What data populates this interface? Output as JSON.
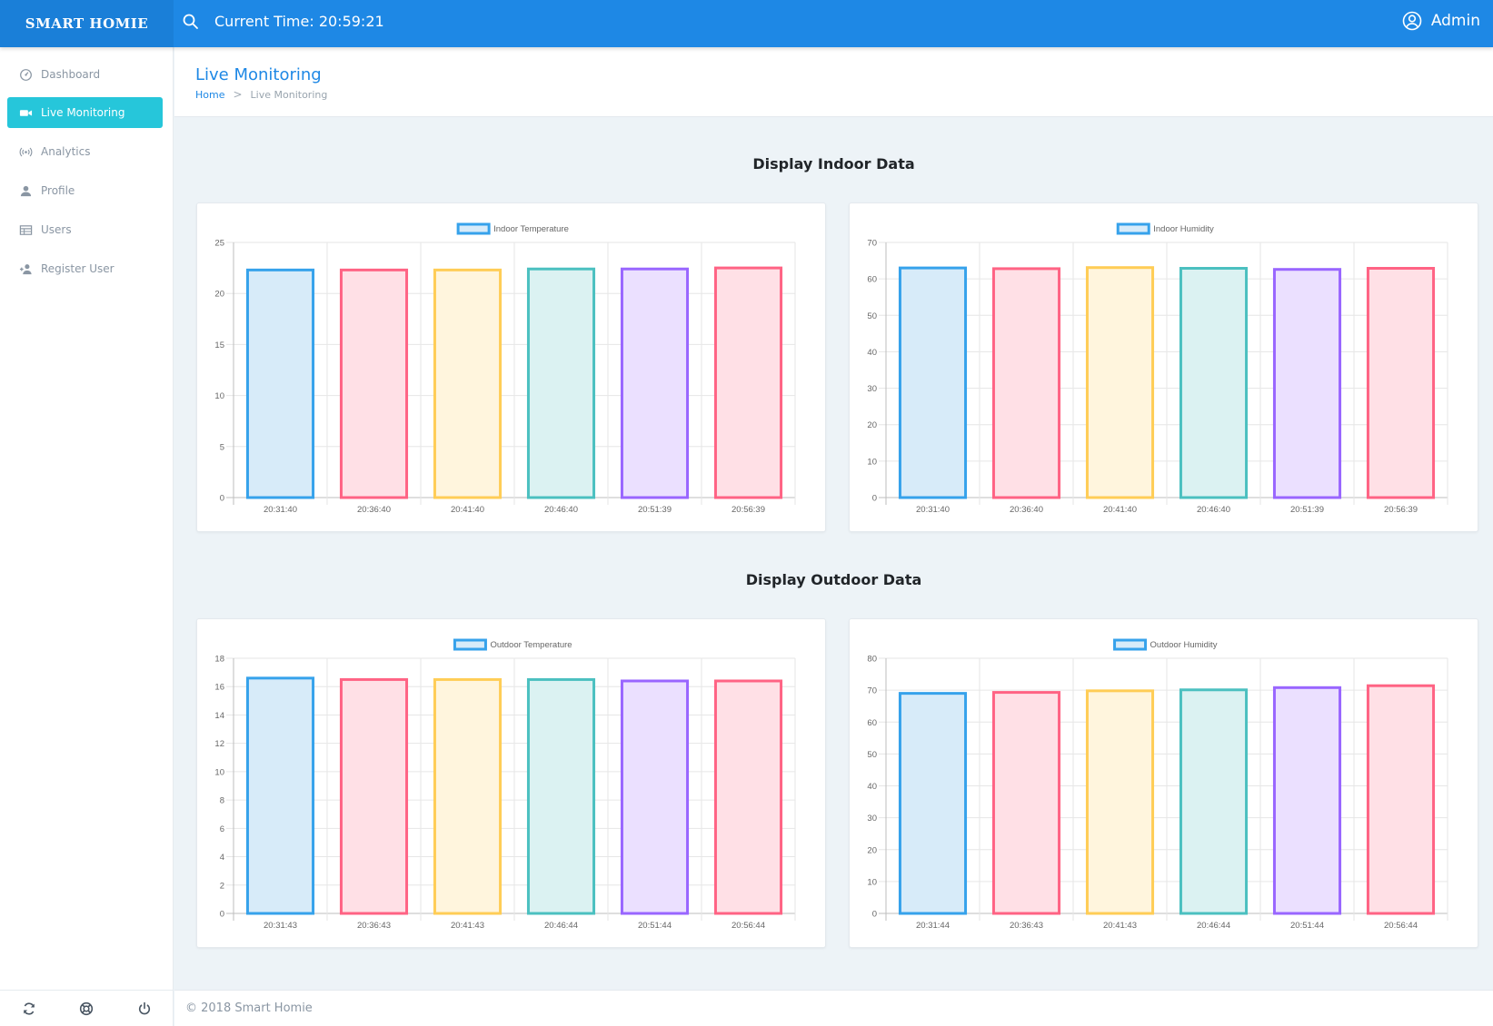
{
  "app": {
    "brand": "SMART HOMIE",
    "clock_text": "Current Time: 20:59:21",
    "user_name": "Admin"
  },
  "sidebar": {
    "items": [
      {
        "label": "Dashboard",
        "icon": "dashboard-icon",
        "active": false
      },
      {
        "label": "Live Monitoring",
        "icon": "video-camera-icon",
        "active": true
      },
      {
        "label": "Analytics",
        "icon": "broadcast-icon",
        "active": false
      },
      {
        "label": "Profile",
        "icon": "person-icon",
        "active": false
      },
      {
        "label": "Users",
        "icon": "table-icon",
        "active": false
      },
      {
        "label": "Register User",
        "icon": "add-user-icon",
        "active": false
      }
    ],
    "footer_icons": [
      "refresh-icon",
      "lifebuoy-icon",
      "power-icon"
    ]
  },
  "page": {
    "title": "Live Monitoring",
    "breadcrumb": {
      "home": "Home",
      "separator": ">",
      "current": "Live Monitoring"
    }
  },
  "sections": {
    "indoor_title": "Display Indoor Data",
    "outdoor_title": "Display Outdoor Data"
  },
  "footer": {
    "text": "© 2018 Smart Homie"
  },
  "colors": {
    "primary": "#1e88e5",
    "active_nav": "#26c6da",
    "bar_border": [
      "#36a2eb",
      "#ff6384",
      "#ffcd56",
      "#4bc0c0",
      "#9966ff",
      "#ff6384"
    ],
    "bar_fill": [
      "#d7ebf9",
      "#ffe0e6",
      "#fff5dd",
      "#dbf2f2",
      "#ebe0ff",
      "#ffe0e6"
    ]
  },
  "chart_data": [
    {
      "type": "bar",
      "legend": "Indoor Temperature",
      "categories": [
        "20:31:40",
        "20:36:40",
        "20:41:40",
        "20:46:40",
        "20:51:39",
        "20:56:39"
      ],
      "values": [
        22.3,
        22.3,
        22.3,
        22.4,
        22.4,
        22.5
      ],
      "ylim": [
        0,
        25
      ],
      "yticks": [
        0,
        5,
        10,
        15,
        20,
        25
      ]
    },
    {
      "type": "bar",
      "legend": "Indoor Humidity",
      "categories": [
        "20:31:40",
        "20:36:40",
        "20:41:40",
        "20:46:40",
        "20:51:39",
        "20:56:39"
      ],
      "values": [
        63,
        62.8,
        63.1,
        62.9,
        62.6,
        62.9
      ],
      "ylim": [
        0,
        70
      ],
      "yticks": [
        0,
        10,
        20,
        30,
        40,
        50,
        60,
        70
      ]
    },
    {
      "type": "bar",
      "legend": "Outdoor Temperature",
      "categories": [
        "20:31:43",
        "20:36:43",
        "20:41:43",
        "20:46:44",
        "20:51:44",
        "20:56:44"
      ],
      "values": [
        16.6,
        16.5,
        16.5,
        16.5,
        16.4,
        16.4
      ],
      "ylim": [
        0,
        18
      ],
      "yticks": [
        0,
        2,
        4,
        6,
        8,
        10,
        12,
        14,
        16,
        18
      ]
    },
    {
      "type": "bar",
      "legend": "Outdoor Humidity",
      "categories": [
        "20:31:44",
        "20:36:43",
        "20:41:43",
        "20:46:44",
        "20:51:44",
        "20:56:44"
      ],
      "values": [
        69,
        69.3,
        69.8,
        70.1,
        70.8,
        71.4
      ],
      "ylim": [
        0,
        80
      ],
      "yticks": [
        0,
        10,
        20,
        30,
        40,
        50,
        60,
        70,
        80
      ]
    }
  ]
}
